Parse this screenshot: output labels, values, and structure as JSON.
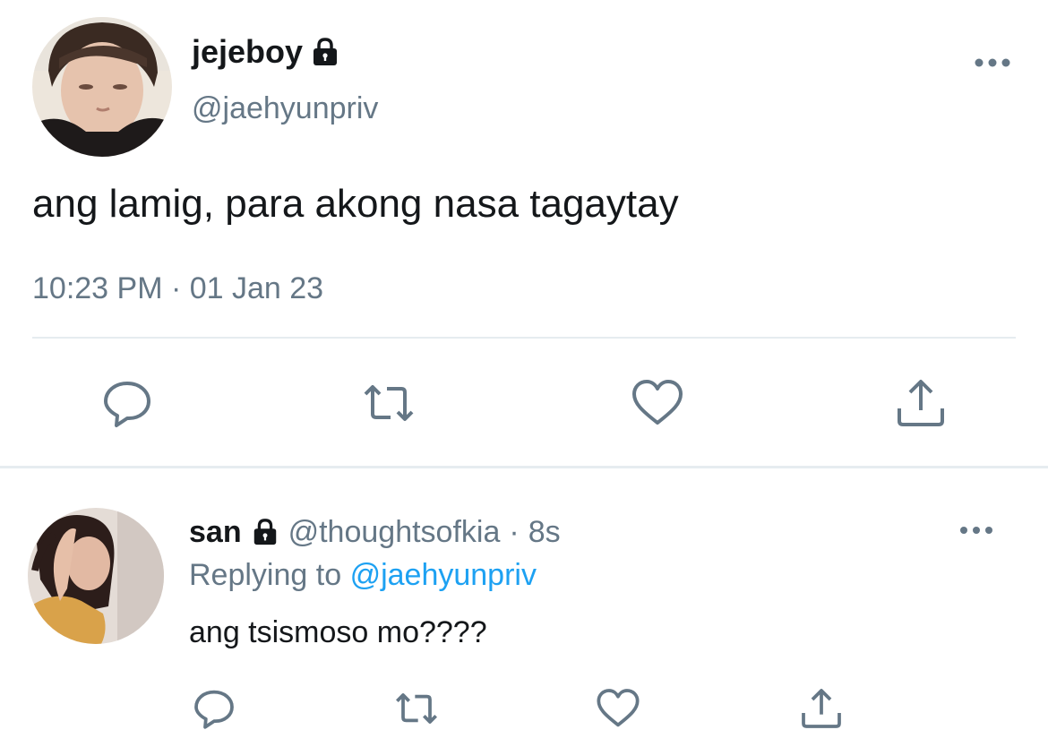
{
  "main_tweet": {
    "display_name": "jejeboy",
    "handle": "@jaehyunpriv",
    "text": "ang lamig, para akong nasa tagaytay",
    "timestamp": "10:23 PM · 01 Jan 23",
    "protected_icon": "lock-icon",
    "more_icon": "more-dots-icon",
    "actions": [
      {
        "icon": "reply-icon"
      },
      {
        "icon": "retweet-icon"
      },
      {
        "icon": "like-icon"
      },
      {
        "icon": "share-icon"
      }
    ]
  },
  "reply_tweet": {
    "display_name": "san",
    "handle": "@thoughtsofkia",
    "separator": "·",
    "age": "8s",
    "replying_prefix": "Replying to",
    "replying_to": "@jaehyunpriv",
    "text": "ang tsismoso mo????",
    "protected_icon": "lock-icon",
    "more_icon": "more-dots-icon",
    "actions": [
      {
        "icon": "reply-icon"
      },
      {
        "icon": "retweet-icon"
      },
      {
        "icon": "like-icon"
      },
      {
        "icon": "share-icon"
      }
    ]
  },
  "colors": {
    "text": "#14171a",
    "secondary": "#657786",
    "link": "#1da1f2",
    "divider": "#e6ecf0"
  }
}
